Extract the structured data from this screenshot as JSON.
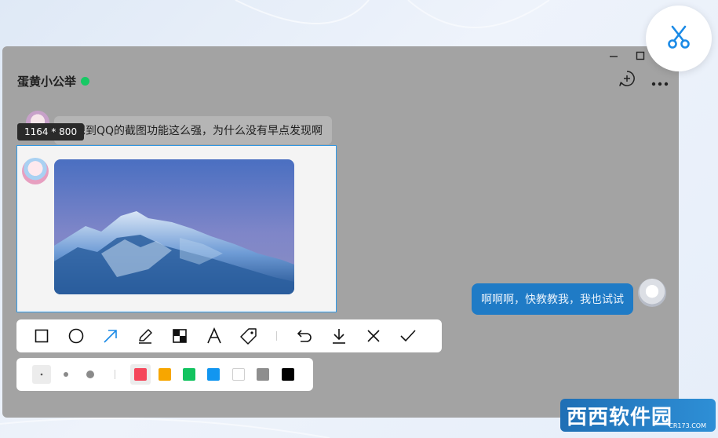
{
  "chat": {
    "contact_name": "蛋黄小公举",
    "status_color": "#17c964",
    "header_icons": [
      "add-chat-icon",
      "more-icon"
    ],
    "window_controls": [
      "minimize-icon",
      "maximize-icon"
    ]
  },
  "messages": {
    "incoming_text": "没想到QQ的截图功能这么强，为什么没有早点发现啊",
    "outgoing_text": "啊啊啊，快教教我，我也试试"
  },
  "screenshot": {
    "size_tip": "1164 * 800",
    "selection_color": "#2f9ae8"
  },
  "toolbar": {
    "tools": [
      "rectangle-icon",
      "ellipse-icon",
      "arrow-icon",
      "pen-icon",
      "mosaic-icon",
      "text-icon",
      "tag-icon"
    ],
    "actions": [
      "undo-icon",
      "download-icon",
      "cancel-icon",
      "confirm-icon"
    ],
    "active_tool": "arrow-icon"
  },
  "palette": {
    "brush_sizes": [
      "small",
      "medium",
      "large"
    ],
    "selected_size": "small",
    "colors": [
      "#f5475b",
      "#f7a600",
      "#12c35f",
      "#1296f0",
      "#ffffff",
      "#8e8e8e",
      "#000000"
    ],
    "selected_color": "#f5475b"
  },
  "floating": {
    "scissor_icon": "scissors-icon",
    "accent": "#1a8ae6"
  },
  "watermark": {
    "text": "西西软件园",
    "sub": "CR173.COM"
  }
}
